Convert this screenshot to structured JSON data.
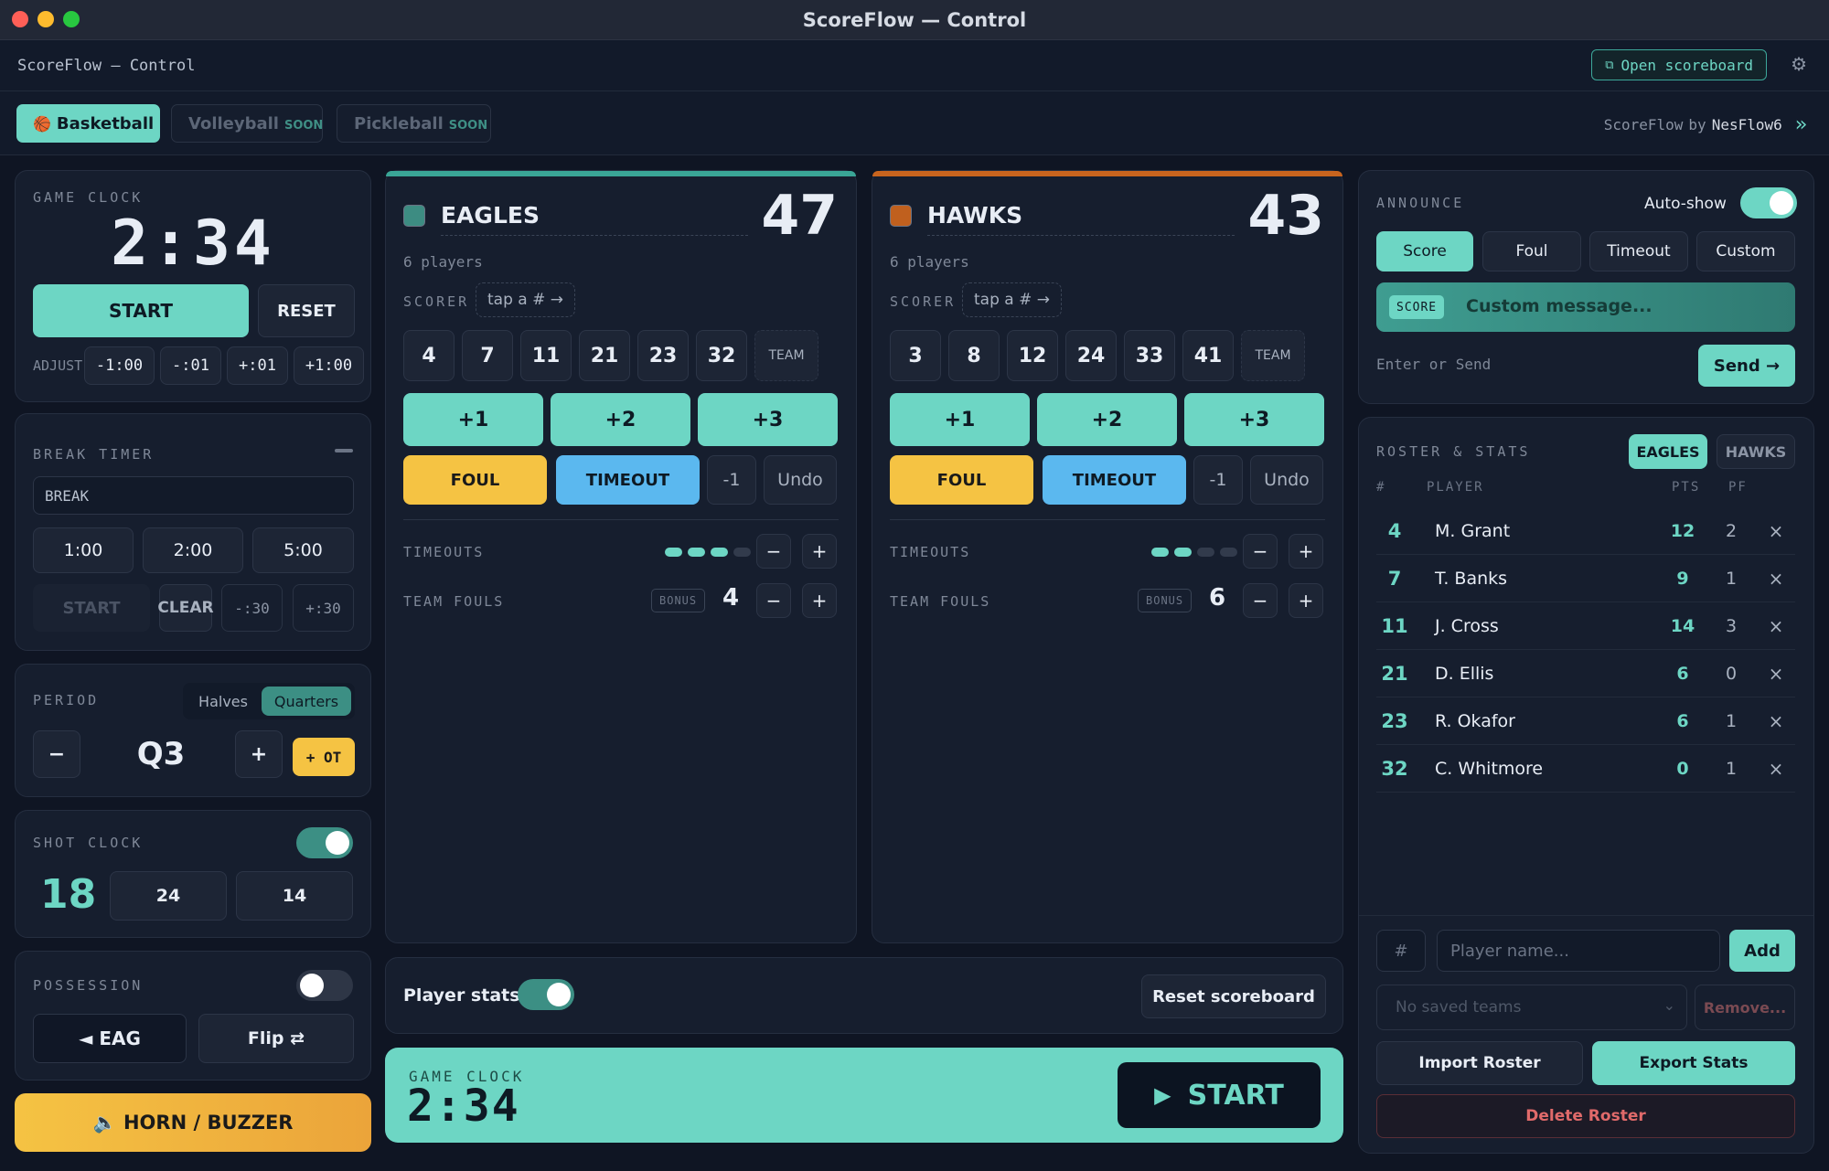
{
  "window": {
    "title": "ScoreFlow — Control"
  },
  "appbar": {
    "title": "ScoreFlow — Control",
    "open_scoreboard": "Open scoreboard"
  },
  "sports": [
    {
      "label": "Basketball",
      "icon": "🏀"
    },
    {
      "label": "Volleyball",
      "badge": "SOON"
    },
    {
      "label": "Pickleball",
      "badge": "SOON"
    }
  ],
  "brand": {
    "prefix": "ScoreFlow",
    "by": "by",
    "name": "NesFlow6"
  },
  "game_clock": {
    "label": "GAME CLOCK",
    "time": "2:34",
    "start": "START",
    "reset": "RESET",
    "adjust_label": "ADJUST",
    "adjust": [
      "-1:00",
      "-:01",
      "+:01",
      "+1:00"
    ]
  },
  "break_timer": {
    "label": "BREAK TIMER",
    "input_value": "BREAK",
    "presets": [
      "1:00",
      "2:00",
      "5:00"
    ],
    "start": "START",
    "clear": "CLEAR",
    "adjust": [
      "-:30",
      "+:30"
    ]
  },
  "period": {
    "label": "PERIOD",
    "modes": [
      "Halves",
      "Quarters"
    ],
    "selected_mode": "Quarters",
    "value": "Q3",
    "minus": "−",
    "plus": "+",
    "ot": "+ OT"
  },
  "shot_clock": {
    "label": "SHOT CLOCK",
    "value": "18",
    "presets": [
      "24",
      "14"
    ],
    "enabled": true
  },
  "possession": {
    "label": "POSSESSION",
    "team": "◄ EAG",
    "flip": "Flip ⇄",
    "enabled": false
  },
  "horn": {
    "label": "🔈 HORN / BUZZER"
  },
  "teams": [
    {
      "name": "EAGLES",
      "score": "47",
      "players": "6 players",
      "color": "#3aa596",
      "swatch": "#3d8c82",
      "scorer_label": "SCORER",
      "scorer_hint": "tap a # →",
      "numbers": [
        "4",
        "7",
        "11",
        "21",
        "23",
        "32"
      ],
      "team_btn": "TEAM",
      "points": [
        "+1",
        "+2",
        "+3"
      ],
      "foul": "FOUL",
      "timeout": "TIMEOUT",
      "minus": "-1",
      "undo": "Undo",
      "timeouts_label": "TIMEOUTS",
      "timeouts_used": 3,
      "timeouts_total": 4,
      "fouls_label": "TEAM FOULS",
      "bonus": "BONUS",
      "fouls": "4"
    },
    {
      "name": "HAWKS",
      "score": "43",
      "players": "6 players",
      "color": "#c8641e",
      "swatch": "#c0601e",
      "scorer_label": "SCORER",
      "scorer_hint": "tap a # →",
      "numbers": [
        "3",
        "8",
        "12",
        "24",
        "33",
        "41"
      ],
      "team_btn": "TEAM",
      "points": [
        "+1",
        "+2",
        "+3"
      ],
      "foul": "FOUL",
      "timeout": "TIMEOUT",
      "minus": "-1",
      "undo": "Undo",
      "timeouts_label": "TIMEOUTS",
      "timeouts_used": 2,
      "timeouts_total": 4,
      "fouls_label": "TEAM FOULS",
      "bonus": "BONUS",
      "fouls": "6"
    }
  ],
  "bottom": {
    "player_stats": "Player stats",
    "reset": "Reset scoreboard",
    "clock_label": "GAME CLOCK",
    "clock_time": "2:34",
    "start": "START"
  },
  "announce": {
    "label": "ANNOUNCE",
    "auto_show": "Auto-show",
    "tabs": [
      "Score",
      "Foul",
      "Timeout",
      "Custom"
    ],
    "selected": "Score",
    "tag": "SCORE",
    "placeholder": "Custom message...",
    "hint": "Enter or Send",
    "send": "Send →"
  },
  "roster": {
    "label": "ROSTER & STATS",
    "teams": [
      "EAGLES",
      "HAWKS"
    ],
    "selected": "EAGLES",
    "columns": {
      "num": "#",
      "player": "PLAYER",
      "pts": "PTS",
      "pf": "PF"
    },
    "rows": [
      {
        "num": "4",
        "name": "M. Grant",
        "pts": "12",
        "pf": "2"
      },
      {
        "num": "7",
        "name": "T. Banks",
        "pts": "9",
        "pf": "1"
      },
      {
        "num": "11",
        "name": "J. Cross",
        "pts": "14",
        "pf": "3"
      },
      {
        "num": "21",
        "name": "D. Ellis",
        "pts": "6",
        "pf": "0"
      },
      {
        "num": "23",
        "name": "R. Okafor",
        "pts": "6",
        "pf": "1"
      },
      {
        "num": "32",
        "name": "C. Whitmore",
        "pts": "0",
        "pf": "1"
      }
    ],
    "remove_glyph": "×",
    "num_placeholder": "#",
    "name_placeholder": "Player name...",
    "add": "Add",
    "saved_teams": "No saved teams",
    "remove": "Remove...",
    "import": "Import Roster",
    "export": "Export Stats",
    "delete": "Delete Roster"
  },
  "colors": {
    "accent": "#6dd6c4",
    "foul": "#f5c343",
    "timeout": "#5bb8ef",
    "danger": "#e06a6a"
  }
}
